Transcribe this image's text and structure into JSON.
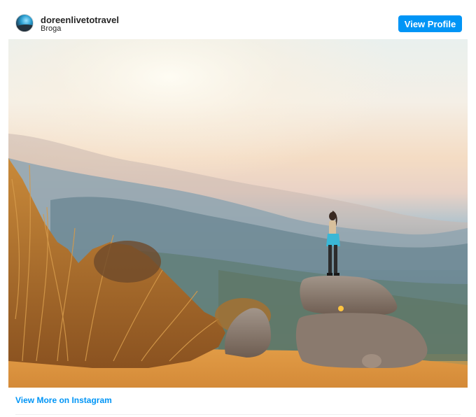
{
  "header": {
    "username": "doreenlivetotravel",
    "location": "Broga",
    "view_profile_label": "View Profile"
  },
  "photo": {
    "subject": "photo-hiker-on-rock"
  },
  "footer": {
    "view_more_label": "View More on Instagram"
  },
  "colors": {
    "accent": "#0095f6",
    "text": "#262626",
    "divider": "#efefef"
  }
}
